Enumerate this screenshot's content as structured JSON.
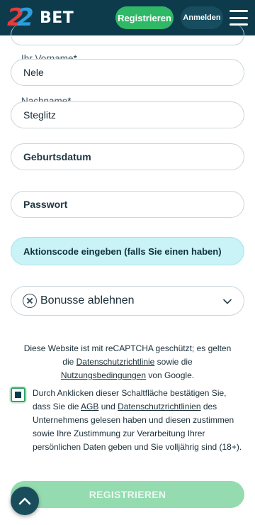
{
  "header": {
    "logo_number": "22",
    "logo_text": "BET",
    "register_label": "Registrieren",
    "login_label": "Anmelden",
    "menu_icon": "hamburger-menu-icon"
  },
  "form": {
    "first_name": {
      "label": "Ihr Vorname",
      "required_mark": "*",
      "value": "Nele"
    },
    "last_name": {
      "label": "Nachname",
      "required_mark": "*",
      "value": "Steglitz"
    },
    "birthdate": {
      "placeholder": "Geburtsdatum"
    },
    "password": {
      "placeholder": "Passwort"
    },
    "promo_code": {
      "placeholder": "Aktionscode eingeben (falls Sie einen haben)"
    },
    "bonus": {
      "selected": "Bonusse ablehnen",
      "icon": "close-circle-icon",
      "chevron": "chevron-down-icon"
    }
  },
  "captcha_notice": {
    "text_before": "Diese Website ist mit reCAPTCHA geschützt; es gelten die ",
    "privacy_link": "Datenschutzrichtlinie",
    "text_middle": " sowie die ",
    "terms_link": "Nutzungsbedingungen",
    "text_after": " von Google."
  },
  "consent": {
    "checked": true,
    "text_before": "Durch Anklicken dieser Schaltfläche bestätigen Sie, dass Sie die ",
    "agb_link": "AGB",
    "text_and": " und ",
    "privacy_link": "Datenschutzrichtlinien",
    "text_after": " des Unternehmens gelesen haben und diesen zustimmen sowie Ihre Zustimmung zur Verarbeitung Ihrer persönlichen Daten geben und Sie volljährig sind (18+)."
  },
  "submit": {
    "label": "REGISTRIEREN"
  },
  "scroll_top": {
    "icon": "chevron-up-icon"
  },
  "colors": {
    "header_bg": "#0d3b4c",
    "accent_green": "#2fb866",
    "submit_disabled": "#94dcb0",
    "promo_bg": "#c9f3f6"
  }
}
